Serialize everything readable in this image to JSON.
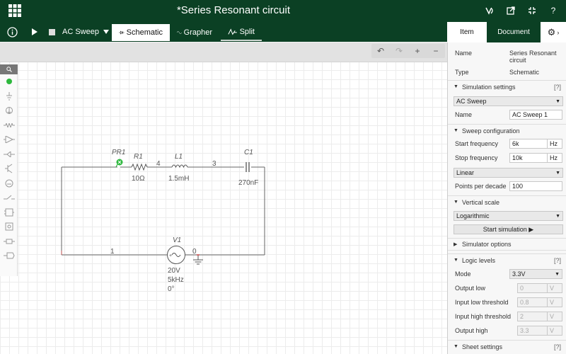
{
  "header": {
    "title": "*Series Resonant circuit"
  },
  "toolbar": {
    "mode": "AC Sweep",
    "tabs": [
      {
        "label": "Schematic"
      },
      {
        "label": "Grapher"
      },
      {
        "label": "Split"
      }
    ]
  },
  "panel_tabs": {
    "item": "Item",
    "document": "Document"
  },
  "properties": {
    "name_label": "Name",
    "name_value": "Series Resonant circuit",
    "type_label": "Type",
    "type_value": "Schematic"
  },
  "simulation": {
    "section_label": "Simulation settings",
    "help": "[?]",
    "analysis": "AC Sweep",
    "name_label": "Name",
    "name_value": "AC Sweep 1",
    "sweep_label": "Sweep configuration",
    "start_label": "Start frequency",
    "start_value": "6k",
    "start_unit": "Hz",
    "stop_label": "Stop frequency",
    "stop_value": "10k",
    "stop_unit": "Hz",
    "sweep_type": "Linear",
    "points_label": "Points per decade",
    "points_value": "100",
    "vscale_label": "Vertical scale",
    "vscale_value": "Logarithmic",
    "start_button": "Start simulation ▶",
    "options_label": "Simulator options"
  },
  "logic": {
    "section_label": "Logic levels",
    "help": "[?]",
    "mode_label": "Mode",
    "mode_value": "3.3V",
    "output_low_label": "Output low",
    "output_low_value": "0",
    "input_low_label": "Input low threshold",
    "input_low_value": "0.8",
    "input_high_label": "Input high threshold",
    "input_high_value": "2",
    "output_high_label": "Output high",
    "output_high_value": "3.3",
    "unit": "V"
  },
  "sheet": {
    "section_label": "Sheet settings",
    "help": "[?]"
  },
  "circuit": {
    "probe": "PR1",
    "r1_name": "R1",
    "r1_value": "10Ω",
    "l1_name": "L1",
    "l1_value": "1.5mH",
    "c1_name": "C1",
    "c1_value": "270nF",
    "v1_name": "V1",
    "v1_amp": "20V",
    "v1_freq": "5kHz",
    "v1_phase": "0°",
    "node1": "1",
    "node0": "0",
    "node3": "3",
    "node4": "4"
  },
  "colors": {
    "header_bg": "#0b4024",
    "probe": "#2db83d"
  }
}
